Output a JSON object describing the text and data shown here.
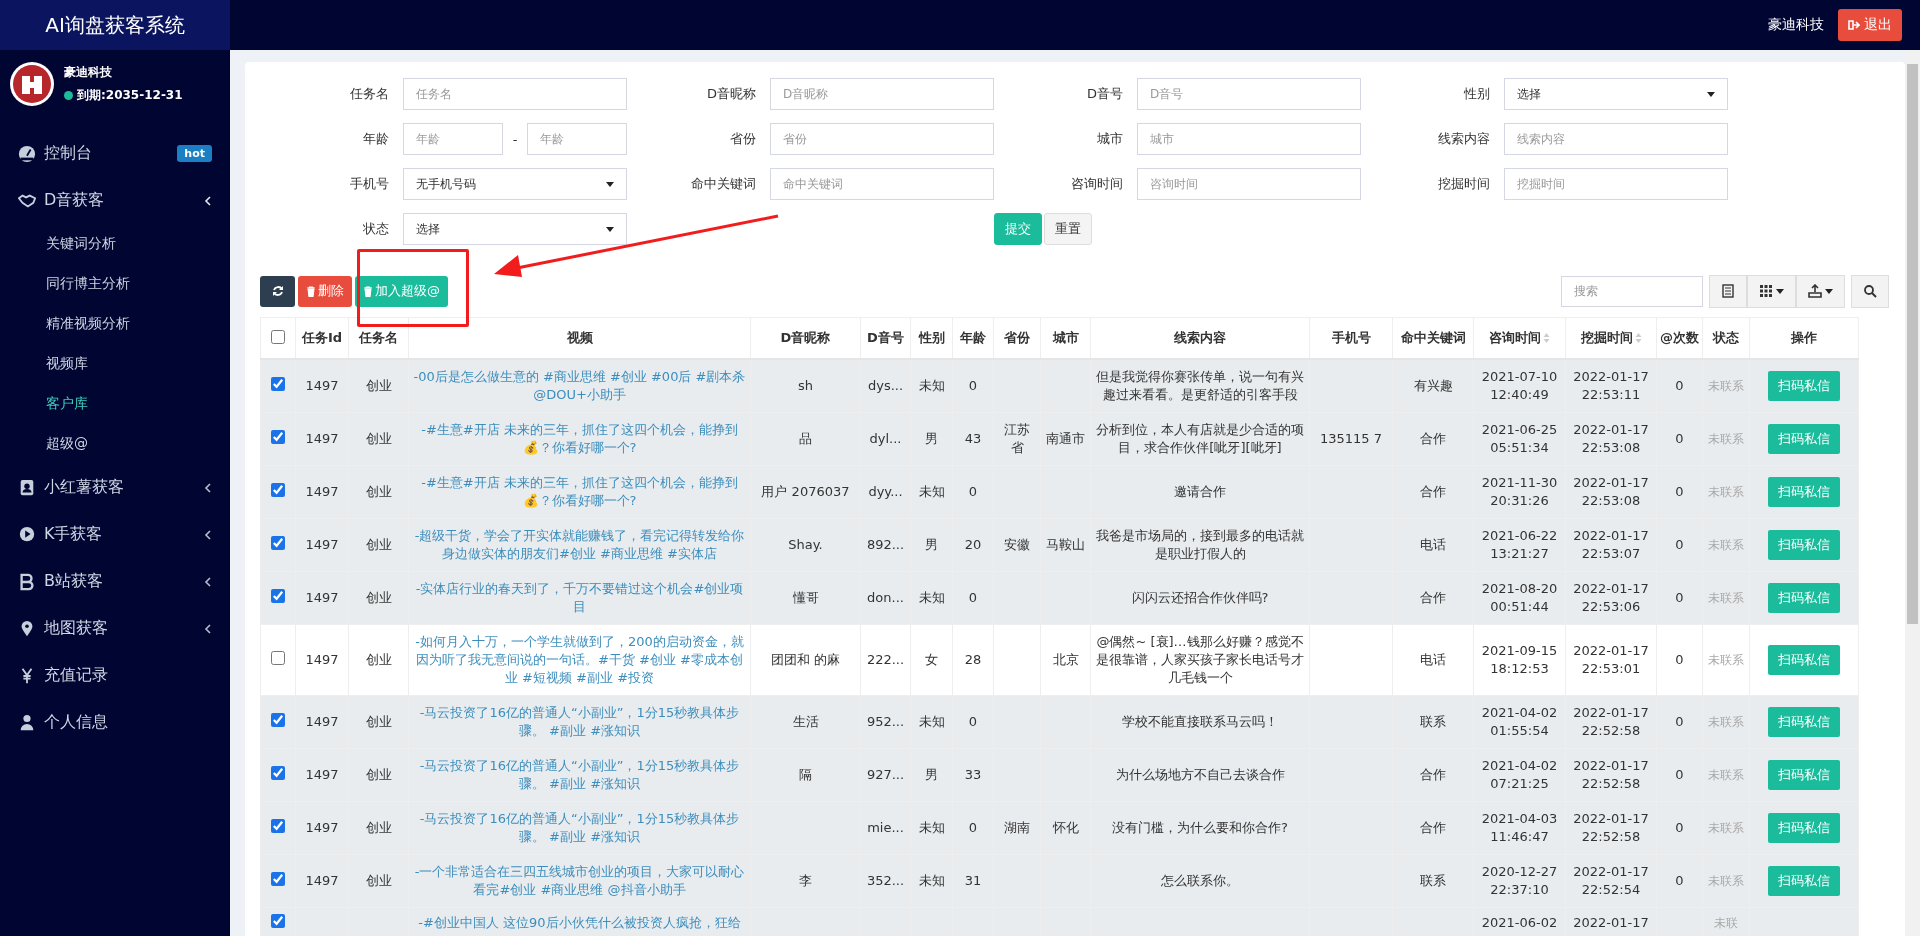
{
  "app_title": "AI询盘获客系统",
  "profile": {
    "name": "豪迪科技",
    "expiry": "到期:2035-12-31",
    "online": true
  },
  "nav": [
    {
      "kind": "dashboard",
      "label": "控制台",
      "badge": "hot"
    },
    {
      "kind": "handshake",
      "label": "D音获客",
      "expanded": true,
      "children": [
        {
          "label": "关键词分析",
          "selected": false
        },
        {
          "label": "同行博主分析",
          "selected": false
        },
        {
          "label": "精准视频分析",
          "selected": false
        },
        {
          "label": "视频库",
          "selected": false
        },
        {
          "label": "客户库",
          "selected": true
        },
        {
          "label": "超级@",
          "selected": false
        }
      ]
    },
    {
      "kind": "contacts",
      "label": "小红薯获客",
      "expanded": false
    },
    {
      "kind": "play",
      "label": "K手获客",
      "expanded": false
    },
    {
      "kind": "letter-b",
      "label": "B站获客",
      "expanded": false
    },
    {
      "kind": "pin",
      "label": "地图获客",
      "expanded": false
    },
    {
      "kind": "yen",
      "label": "充值记录"
    },
    {
      "kind": "user",
      "label": "个人信息"
    }
  ],
  "header": {
    "user": "豪迪科技",
    "logout": "退出"
  },
  "filters": [
    {
      "kind": "text",
      "label": "任务名",
      "placeholder": "任务名"
    },
    {
      "kind": "text",
      "label": "D音昵称",
      "placeholder": "D音昵称"
    },
    {
      "kind": "text",
      "label": "D音号",
      "placeholder": "D音号"
    },
    {
      "kind": "select",
      "label": "性别",
      "value": "选择"
    },
    {
      "kind": "range",
      "label": "年龄",
      "placeholder": "年龄",
      "separator": "-",
      "placeholder_to": "年龄"
    },
    {
      "kind": "text",
      "label": "省份",
      "placeholder": "省份"
    },
    {
      "kind": "text",
      "label": "城市",
      "placeholder": "城市"
    },
    {
      "kind": "text",
      "label": "线索内容",
      "placeholder": "线索内容"
    },
    {
      "kind": "select",
      "label": "手机号",
      "value": "无手机号码"
    },
    {
      "kind": "text",
      "label": "命中关键词",
      "placeholder": "命中关键词"
    },
    {
      "kind": "text",
      "label": "咨询时间",
      "placeholder": "咨询时间"
    },
    {
      "kind": "text",
      "label": "挖掘时间",
      "placeholder": "挖掘时间"
    },
    {
      "kind": "select",
      "label": "状态",
      "value": "选择"
    },
    {
      "kind": "buttons",
      "buttons": [
        {
          "kind": "primary",
          "label": "提交"
        },
        {
          "kind": "default",
          "label": "重置"
        }
      ]
    }
  ],
  "toolbar": {
    "buttons": [
      {
        "kind": "refresh"
      },
      {
        "kind": "delete",
        "label": "删除"
      },
      {
        "kind": "add",
        "label": "加入超级@"
      }
    ],
    "search_placeholder": "搜索",
    "tools": [
      {
        "kind": "list",
        "dropdown": false
      },
      {
        "kind": "grid",
        "dropdown": true
      },
      {
        "kind": "export",
        "dropdown": true
      },
      {
        "kind": "search",
        "dropdown": false
      }
    ]
  },
  "table": {
    "select_all": false,
    "columns": [
      {
        "label": "任务Id",
        "kind": "text",
        "sortable": false
      },
      {
        "label": "任务名",
        "kind": "text",
        "sortable": false
      },
      {
        "label": "视频",
        "kind": "link",
        "sortable": false
      },
      {
        "label": "D音昵称",
        "kind": "text",
        "sortable": false
      },
      {
        "label": "D音号",
        "kind": "text",
        "sortable": false
      },
      {
        "label": "性别",
        "kind": "text",
        "sortable": false
      },
      {
        "label": "年龄",
        "kind": "text",
        "sortable": false
      },
      {
        "label": "省份",
        "kind": "text",
        "sortable": false
      },
      {
        "label": "城市",
        "kind": "text",
        "sortable": false
      },
      {
        "label": "线索内容",
        "kind": "text",
        "sortable": false
      },
      {
        "label": "手机号",
        "kind": "text",
        "sortable": false
      },
      {
        "label": "命中关键词",
        "kind": "text",
        "sortable": false
      },
      {
        "label": "咨询时间",
        "kind": "text",
        "sortable": true
      },
      {
        "label": "挖掘时间",
        "kind": "text",
        "sortable": true
      },
      {
        "label": "@次数",
        "kind": "text",
        "sortable": false
      },
      {
        "label": "状态",
        "kind": "status",
        "sortable": false
      },
      {
        "label": "操作",
        "kind": "action",
        "sortable": false
      }
    ],
    "rows": [
      {
        "selected": true,
        "partial": false,
        "cells": [
          "1497",
          "创业",
          "-00后是怎么做生意的 #商业思维 #创业 #00后 #剧本杀 @DOU+小助手",
          "sh",
          "dys...",
          "未知",
          "0",
          null,
          null,
          "但是我觉得你赛张传单，说一句有兴趣过来看看。是更舒适的引客手段",
          null,
          "有兴趣",
          "2021-07-10 12:40:49",
          "2022-01-17 22:53:11",
          "0",
          "未联系",
          "扫码私信"
        ]
      },
      {
        "selected": true,
        "partial": false,
        "cells": [
          "1497",
          "创业",
          "-#生意#开店 未来的三年，抓住了这四个机会，能挣到💰？你看好哪一个?",
          "品",
          "dyl...",
          "男",
          "43",
          "江苏省",
          "南通市",
          "分析到位，本人有店就是少合适的项目，求合作伙伴[呲牙][呲牙]",
          "135115 7",
          "合作",
          "2021-06-25 05:51:34",
          "2022-01-17 22:53:08",
          "0",
          "未联系",
          "扫码私信"
        ]
      },
      {
        "selected": true,
        "partial": false,
        "cells": [
          "1497",
          "创业",
          "-#生意#开店 未来的三年，抓住了这四个机会，能挣到💰？你看好哪一个?",
          "用户 2076037",
          "dyy...",
          "未知",
          "0",
          null,
          null,
          "邀请合作",
          null,
          "合作",
          "2021-11-30 20:31:26",
          "2022-01-17 22:53:08",
          "0",
          "未联系",
          "扫码私信"
        ]
      },
      {
        "selected": true,
        "partial": false,
        "cells": [
          "1497",
          "创业",
          "-超级干货，学会了开实体就能赚钱了，看完记得转发给你身边做实体的朋友们#创业 #商业思维 #实体店",
          "Shay.",
          "892...",
          "男",
          "20",
          "安徽",
          "马鞍山",
          "我爸是市场局的，接到最多的电话就是职业打假人的",
          null,
          "电话",
          "2021-06-22 13:21:27",
          "2022-01-17 22:53:07",
          "0",
          "未联系",
          "扫码私信"
        ]
      },
      {
        "selected": true,
        "partial": false,
        "cells": [
          "1497",
          "创业",
          "-实体店行业的春天到了，千万不要错过这个机会#创业项目",
          "懂哥",
          "don...",
          "未知",
          "0",
          null,
          null,
          "闪闪云还招合作伙伴吗?",
          null,
          "合作",
          "2021-08-20 00:51:44",
          "2022-01-17 22:53:06",
          "0",
          "未联系",
          "扫码私信"
        ]
      },
      {
        "selected": false,
        "partial": false,
        "cells": [
          "1497",
          "创业",
          "-如何月入十万，一个学生就做到了，200的启动资金，就因为听了我无意间说的一句话。#干货 #创业 #零成本创业 #短视频 #副业 #投资",
          "团团和 的麻",
          "222...",
          "女",
          "28",
          null,
          "北京",
          "@偶然~ [衰]…钱那么好赚？感觉不是很靠谱，人家买孩子家长电话号才几毛钱一个",
          null,
          "电话",
          "2021-09-15 18:12:53",
          "2022-01-17 22:53:01",
          "0",
          "未联系",
          "扫码私信"
        ]
      },
      {
        "selected": true,
        "partial": false,
        "cells": [
          "1497",
          "创业",
          "-马云投资了16亿的普通人“小副业”，1分15秒教具体步骤。 #副业 #涨知识",
          "生活",
          "952...",
          "未知",
          "0",
          null,
          null,
          "学校不能直接联系马云吗！",
          null,
          "联系",
          "2021-04-02 01:55:54",
          "2022-01-17 22:52:58",
          "0",
          "未联系",
          "扫码私信"
        ]
      },
      {
        "selected": true,
        "partial": false,
        "cells": [
          "1497",
          "创业",
          "-马云投资了16亿的普通人“小副业”，1分15秒教具体步骤。 #副业 #涨知识",
          "隔",
          "927...",
          "男",
          "33",
          null,
          null,
          "为什么场地方不自己去谈合作",
          null,
          "合作",
          "2021-04-02 07:21:25",
          "2022-01-17 22:52:58",
          "0",
          "未联系",
          "扫码私信"
        ]
      },
      {
        "selected": true,
        "partial": false,
        "cells": [
          "1497",
          "创业",
          "-马云投资了16亿的普通人“小副业”，1分15秒教具体步骤。 #副业 #涨知识",
          null,
          "mie...",
          "未知",
          "0",
          "湖南",
          "怀化",
          "没有门槛，为什么要和你合作?",
          null,
          "合作",
          "2021-04-03 11:46:47",
          "2022-01-17 22:52:58",
          "0",
          "未联系",
          "扫码私信"
        ]
      },
      {
        "selected": true,
        "partial": false,
        "cells": [
          "1497",
          "创业",
          "-一个非常适合在三四五线城市创业的项目，大家可以耐心看完#创业 #商业思维 @抖音小助手",
          "李",
          "352...",
          "未知",
          "31",
          null,
          null,
          "怎么联系你。",
          null,
          "联系",
          "2020-12-27 22:37:10",
          "2022-01-17 22:52:54",
          "0",
          "未联系",
          "扫码私信"
        ]
      },
      {
        "selected": true,
        "partial": true,
        "cells": [
          null,
          null,
          "-#创业中国人 这位90后小伙凭什么被投资人疯抢，狂给",
          null,
          null,
          null,
          null,
          null,
          null,
          null,
          null,
          null,
          "2021-06-02",
          "2022-01-17",
          null,
          "未联",
          null
        ]
      }
    ]
  }
}
